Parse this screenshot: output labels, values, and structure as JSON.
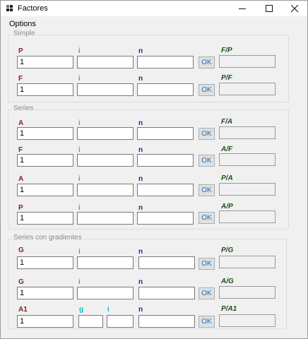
{
  "window": {
    "title": "Factores"
  },
  "menu": {
    "options": "Options"
  },
  "simple": {
    "legend": "Simple",
    "rows": [
      {
        "label_a": "P",
        "label_i": "i",
        "label_n": "n",
        "value_a": "1",
        "value_i": "",
        "value_n": "",
        "ok": "OK",
        "result_label": "F/P",
        "result": ""
      },
      {
        "label_a": "F",
        "label_i": "i",
        "label_n": "n",
        "value_a": "1",
        "value_i": "",
        "value_n": "",
        "ok": "OK",
        "result_label": "P/F",
        "result": ""
      }
    ]
  },
  "series": {
    "legend": "Series",
    "rows": [
      {
        "label_a": "A",
        "label_i": "i",
        "label_n": "n",
        "value_a": "1",
        "value_i": "",
        "value_n": "",
        "ok": "OK",
        "result_label": "F/A",
        "result": ""
      },
      {
        "label_a": "F",
        "label_i": "i",
        "label_n": "n",
        "value_a": "1",
        "value_i": "",
        "value_n": "",
        "ok": "OK",
        "result_label": "A/F",
        "result": ""
      },
      {
        "label_a": "A",
        "label_i": "i",
        "label_n": "n",
        "value_a": "1",
        "value_i": "",
        "value_n": "",
        "ok": "OK",
        "result_label": "P/A",
        "result": ""
      },
      {
        "label_a": "P",
        "label_i": "i",
        "label_n": "n",
        "value_a": "1",
        "value_i": "",
        "value_n": "",
        "ok": "OK",
        "result_label": "A/P",
        "result": ""
      }
    ]
  },
  "gradientes": {
    "legend": "Series con gradientes",
    "rows": [
      {
        "label_a": "G",
        "label_i": "i",
        "label_n": "n",
        "value_a": "1",
        "value_i": "",
        "value_n": "",
        "ok": "OK",
        "result_label": "P/G",
        "result": ""
      },
      {
        "label_a": "G",
        "label_i": "i",
        "label_n": "n",
        "value_a": "1",
        "value_i": "",
        "value_n": "",
        "ok": "OK",
        "result_label": "A/G",
        "result": ""
      },
      {
        "label_a": "A1",
        "label_g": "g",
        "label_i": "i",
        "label_n": "n",
        "value_a": "1",
        "value_g": "",
        "value_i": "",
        "value_n": "",
        "ok": "OK",
        "result_label": "P/A1",
        "result": ""
      }
    ]
  },
  "icons": {
    "app": "app-icon",
    "minimize": "minimize-icon",
    "maximize": "maximize-icon",
    "close": "close-icon"
  }
}
